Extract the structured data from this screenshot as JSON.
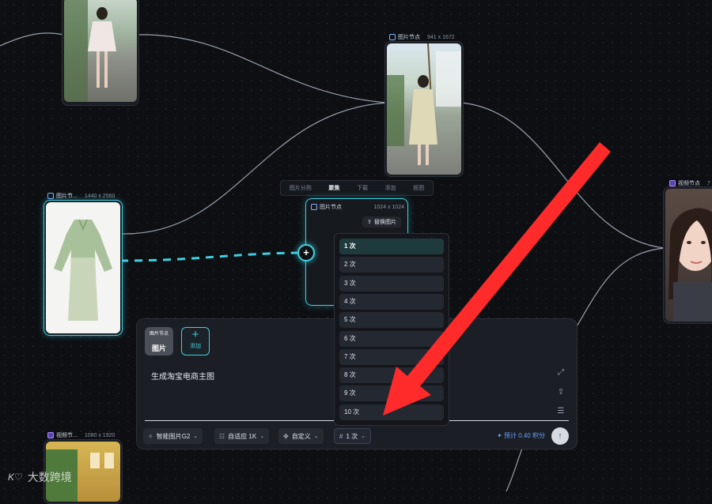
{
  "nodes": {
    "top_center": {
      "title": "图片节点",
      "size": "941 x 1672"
    },
    "left_dress": {
      "title": "图片节...",
      "size": "1440 x 2560"
    },
    "center": {
      "title": "图片节点",
      "size": "1024 x 1024",
      "replace_label": "替换图片"
    },
    "right_video": {
      "title": "视频节点",
      "size": "7"
    },
    "bottom_video": {
      "title": "视频节...",
      "size": "1080 x 1920"
    }
  },
  "node_toolbar": {
    "items": [
      "图片分割",
      "聚焦",
      "下载",
      "添加",
      "抠图"
    ],
    "active_index": 1
  },
  "panel": {
    "ref_thumb_label_top": "图片节点",
    "ref_thumb_label_bottom": "图片",
    "add_label": "添加",
    "prompt": "生成淘宝电商主图",
    "chips": {
      "model": "智能图片G2",
      "ratio": "自适应 1K",
      "custom": "自定义",
      "count": "1 次"
    },
    "estimate": "✦ 预计 0.40 积分"
  },
  "count_dropdown": {
    "options": [
      "1 次",
      "2 次",
      "3 次",
      "4 次",
      "5 次",
      "6 次",
      "7 次",
      "8 次",
      "9 次",
      "10 次"
    ],
    "selected_index": 0
  },
  "watermark": {
    "logo": "K♡",
    "text": "大数跨境"
  },
  "colors": {
    "accent": "#3fd0e0",
    "annotation_arrow": "#ff2b2b",
    "background": "#0d0f13"
  }
}
